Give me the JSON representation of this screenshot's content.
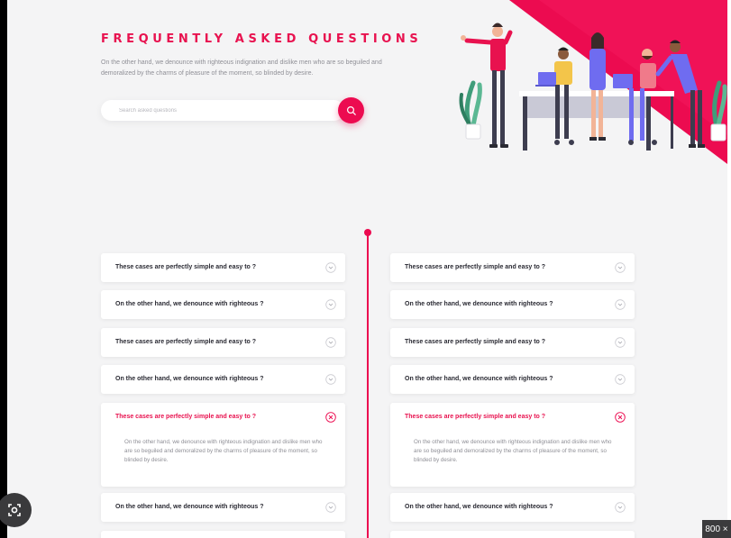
{
  "header": {
    "title": "FREQUENTLY ASKED QUESTIONS",
    "description": "On the other hand, we denounce with righteous indignation and dislike men who are so beguiled and demoralized by the charms of pleasure of the moment, so blinded by desire."
  },
  "search": {
    "placeholder": "Search asked questions",
    "button_icon": "search-icon"
  },
  "colors": {
    "accent": "#ec0b50",
    "background": "#f4f4f5"
  },
  "faq": {
    "left": [
      {
        "question": "These cases are perfectly simple and easy to ?",
        "open": false
      },
      {
        "question": "On the other hand, we denounce with righteous ?",
        "open": false
      },
      {
        "question": "These cases are perfectly simple and easy to ?",
        "open": false
      },
      {
        "question": "On the other hand, we denounce with righteous ?",
        "open": false
      },
      {
        "question": "These cases are perfectly simple and easy to ?",
        "open": true,
        "answer": "On the other hand, we denounce with righteous indignation and dislike men who are so beguiled and demoralized by the charms of pleasure of the moment, so blinded by desire."
      },
      {
        "question": "On the other hand, we denounce with righteous ?",
        "open": false
      }
    ],
    "right": [
      {
        "question": "These cases are perfectly simple and easy to ?",
        "open": false
      },
      {
        "question": "On the other hand, we denounce with righteous ?",
        "open": false
      },
      {
        "question": "These cases are perfectly simple and easy to ?",
        "open": false
      },
      {
        "question": "On the other hand, we denounce with righteous ?",
        "open": false
      },
      {
        "question": "These cases are perfectly simple and easy to ?",
        "open": true,
        "answer": "On the other hand, we denounce with righteous indignation and dislike men who are so beguiled and demoralized by the charms of pleasure of the moment, so blinded by desire."
      },
      {
        "question": "On the other hand, we denounce with righteous ?",
        "open": false
      }
    ]
  },
  "overlay": {
    "badge_text": "800 ×",
    "lens_icon": "lens-icon"
  }
}
